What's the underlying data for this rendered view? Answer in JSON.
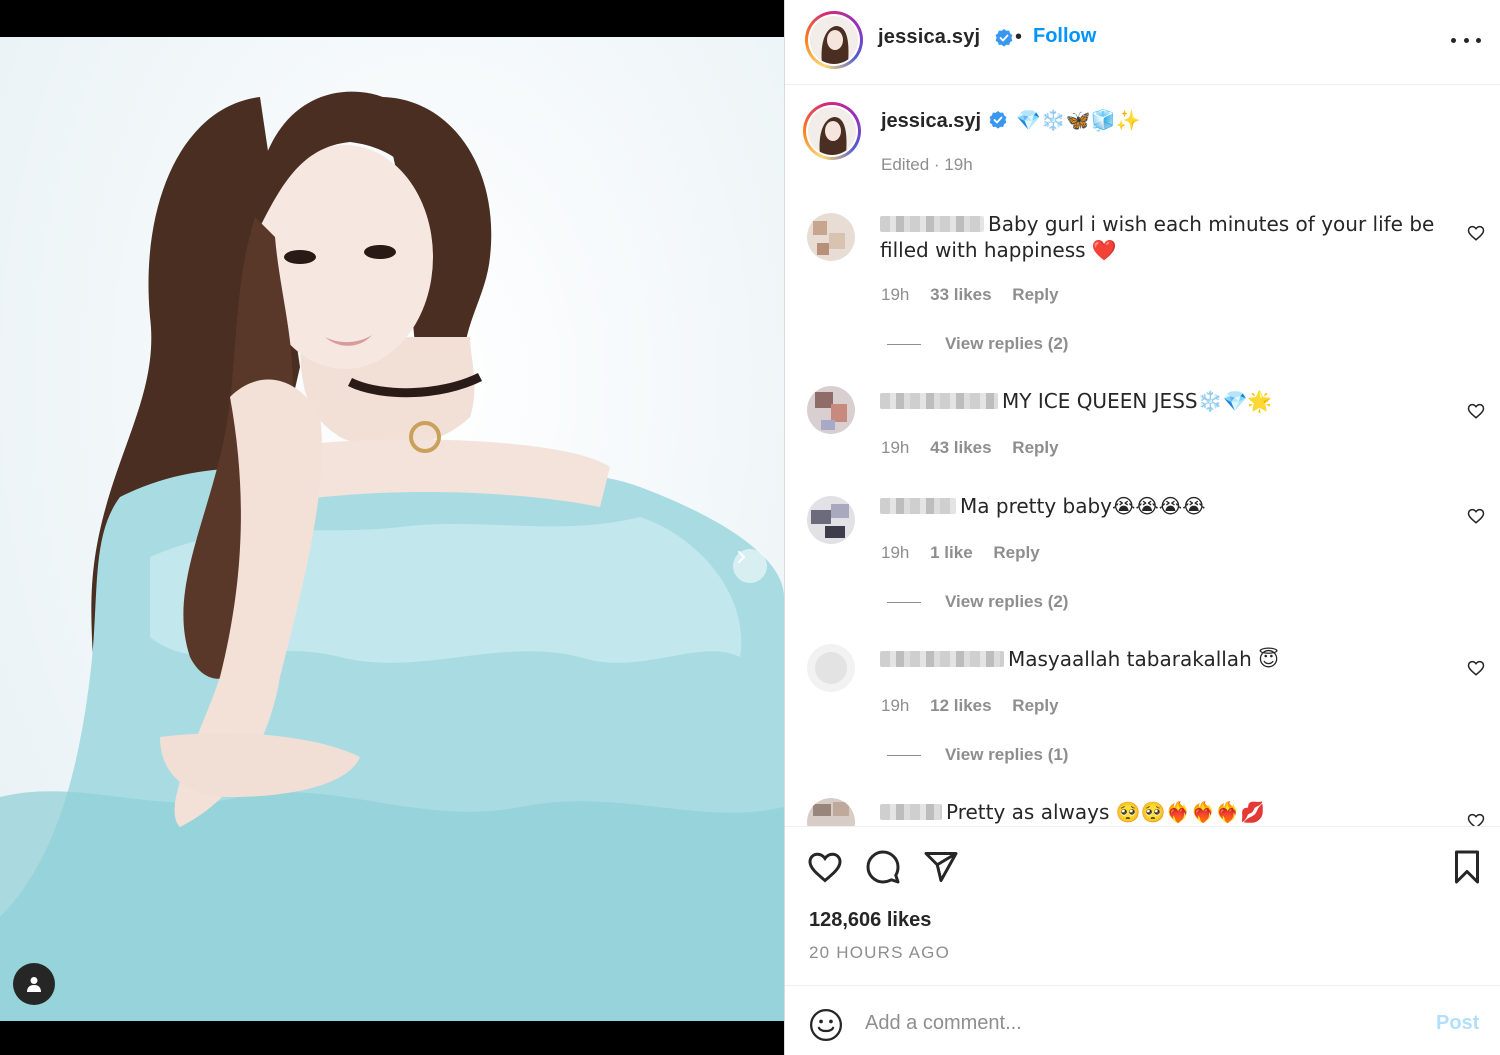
{
  "post": {
    "username": "jessica.syj",
    "follow_label": "Follow",
    "separator": "•"
  },
  "caption": {
    "username": "jessica.syj",
    "text": "💎❄️🦋🧊✨",
    "meta": "Edited · 19h"
  },
  "comments": [
    {
      "text": "Baby gurl i wish each minutes of your life be filled with happiness ❤️",
      "time": "19h",
      "likes": "33 likes",
      "reply": "Reply",
      "view_replies": "View replies (2)"
    },
    {
      "text": "MY ICE QUEEN JESS❄️💎🌟",
      "time": "19h",
      "likes": "43 likes",
      "reply": "Reply"
    },
    {
      "text": "Ma pretty baby😭😭😭😭",
      "time": "19h",
      "likes": "1 like",
      "reply": "Reply",
      "view_replies": "View replies (2)"
    },
    {
      "text": "Masyaallah tabarakallah 😇",
      "time": "19h",
      "likes": "12 likes",
      "reply": "Reply",
      "view_replies": "View replies (1)"
    },
    {
      "text": "Pretty as always 🥺🥺❤️‍🔥❤️‍🔥❤️‍🔥💋"
    }
  ],
  "stats": {
    "likes": "128,606 likes",
    "ago": "20 HOURS AGO"
  },
  "composer": {
    "placeholder": "Add a comment...",
    "post_label": "Post"
  },
  "media": {
    "carousel_count": 2,
    "carousel_active": 0
  },
  "colors": {
    "accent": "#0095f6",
    "verified": "#3897f0",
    "post_disabled": "#b2dffc",
    "muted": "#8e8e8e"
  }
}
